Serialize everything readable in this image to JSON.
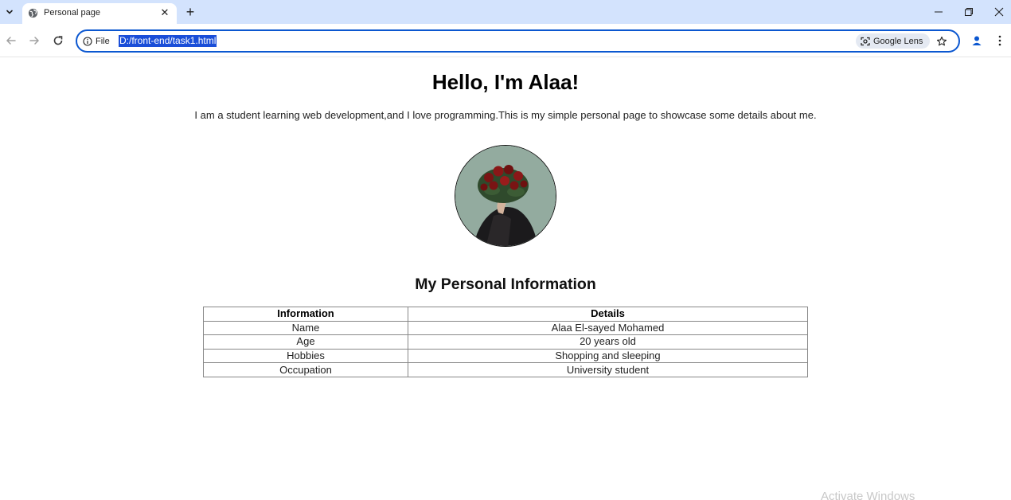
{
  "browser": {
    "tab": {
      "title": "Personal page"
    },
    "address_bar": {
      "scheme_label": "File",
      "url": "D:/front-end/task1.html",
      "lens_label": "Google Lens"
    },
    "icons": [
      "tab-search-icon",
      "globe-icon",
      "close-icon",
      "plus-icon",
      "minimize-icon",
      "restore-icon",
      "window-close-icon",
      "back-arrow-icon",
      "forward-arrow-icon",
      "reload-icon",
      "info-icon",
      "lens-icon",
      "star-icon",
      "profile-icon",
      "kebab-menu-icon"
    ],
    "accent_color": "#0b57d0",
    "tabstrip_color": "#d3e3fd"
  },
  "page": {
    "heading": "Hello, I'm Alaa!",
    "intro": "I am a student learning web development,and I love programming.This is my simple personal page to showcase some details about me.",
    "section_heading": "My Personal Information",
    "table": {
      "headers": [
        "Information",
        "Details"
      ],
      "rows": [
        [
          "Name",
          "Alaa El-sayed Mohamed"
        ],
        [
          "Age",
          "20 years old"
        ],
        [
          "Hobbies",
          "Shopping and sleeping"
        ],
        [
          "Occupation",
          "University student"
        ]
      ]
    }
  },
  "os": {
    "watermark": "Activate Windows"
  }
}
